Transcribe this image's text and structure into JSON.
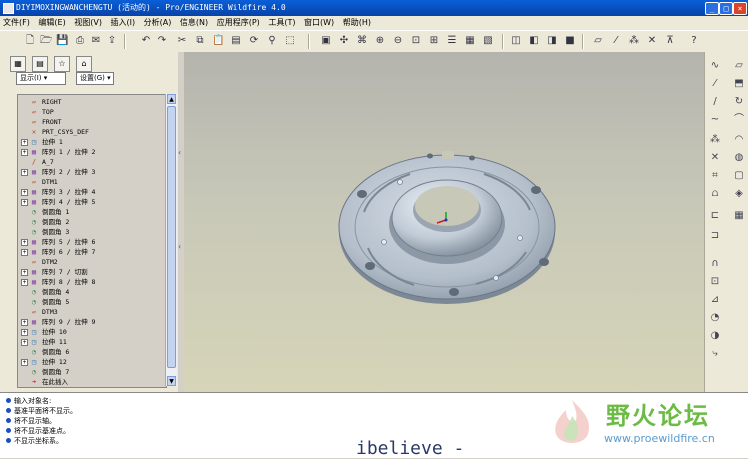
{
  "window": {
    "title": "DIYIMOXINGWANCHENGTU (活动的) - Pro/ENGINEER Wildfire 4.0",
    "controls": [
      "_",
      "□",
      "×"
    ]
  },
  "menu": [
    "文件(F)",
    "编辑(E)",
    "视图(V)",
    "插入(I)",
    "分析(A)",
    "信息(N)",
    "应用程序(P)",
    "工具(T)",
    "窗口(W)",
    "帮助(H)"
  ],
  "panel": {
    "show_label": "显示(I) ▾",
    "settings_label": "设置(G) ▾"
  },
  "model_tree": [
    {
      "label": "RIGHT",
      "icon": "datum-plane-icon",
      "expand": ""
    },
    {
      "label": "TOP",
      "icon": "datum-plane-icon",
      "expand": ""
    },
    {
      "label": "FRONT",
      "icon": "datum-plane-icon",
      "expand": ""
    },
    {
      "label": "PRT_CSYS_DEF",
      "icon": "csys-icon",
      "expand": ""
    },
    {
      "label": "拉伸 1",
      "icon": "extrude-icon",
      "expand": "+"
    },
    {
      "label": "阵列 1 / 拉伸 2",
      "icon": "pattern-icon",
      "expand": "+"
    },
    {
      "label": "A_7",
      "icon": "axis-icon",
      "expand": ""
    },
    {
      "label": "阵列 2 / 拉伸 3",
      "icon": "pattern-icon",
      "expand": "+"
    },
    {
      "label": "DTM1",
      "icon": "datum-plane-icon",
      "expand": ""
    },
    {
      "label": "阵列 3 / 拉伸 4",
      "icon": "pattern-icon",
      "expand": "+"
    },
    {
      "label": "阵列 4 / 拉伸 5",
      "icon": "pattern-icon",
      "expand": "+"
    },
    {
      "label": "倒圆角 1",
      "icon": "round-icon",
      "expand": ""
    },
    {
      "label": "倒圆角 2",
      "icon": "round-icon",
      "expand": ""
    },
    {
      "label": "倒圆角 3",
      "icon": "round-icon",
      "expand": ""
    },
    {
      "label": "阵列 5 / 拉伸 6",
      "icon": "pattern-icon",
      "expand": "+"
    },
    {
      "label": "阵列 6 / 拉伸 7",
      "icon": "pattern-icon",
      "expand": "+"
    },
    {
      "label": "DTM2",
      "icon": "datum-plane-icon",
      "expand": ""
    },
    {
      "label": "阵列 7 / 切割",
      "icon": "pattern-icon",
      "expand": "+"
    },
    {
      "label": "阵列 8 / 拉伸 8",
      "icon": "pattern-icon",
      "expand": "+"
    },
    {
      "label": "倒圆角 4",
      "icon": "round-icon",
      "expand": ""
    },
    {
      "label": "倒圆角 5",
      "icon": "round-icon",
      "expand": ""
    },
    {
      "label": "DTM3",
      "icon": "datum-plane-icon",
      "expand": ""
    },
    {
      "label": "阵列 9 / 拉伸 9",
      "icon": "pattern-icon",
      "expand": "+"
    },
    {
      "label": "拉伸 10",
      "icon": "extrude-icon",
      "expand": "+"
    },
    {
      "label": "拉伸 11",
      "icon": "extrude-icon",
      "expand": "+"
    },
    {
      "label": "倒圆角 6",
      "icon": "round-icon",
      "expand": ""
    },
    {
      "label": "拉伸 12",
      "icon": "extrude-icon",
      "expand": "+"
    },
    {
      "label": "倒圆角 7",
      "icon": "round-icon",
      "expand": ""
    },
    {
      "label": "在此插入",
      "icon": "insert-here-icon",
      "expand": ""
    }
  ],
  "messages": [
    "输入对象名:",
    "基准平面将不显示。",
    "将不显示轴。",
    "将不显示基准点。",
    "不显示坐标系。"
  ],
  "watermark": {
    "title": "野火论坛",
    "url": "www.proewildfire.cn"
  },
  "overlay_text": "ibelieve -",
  "colors": {
    "titlebar": "#0842a8",
    "part": "#b9c3cf",
    "viewport": "#c8c8b8"
  }
}
